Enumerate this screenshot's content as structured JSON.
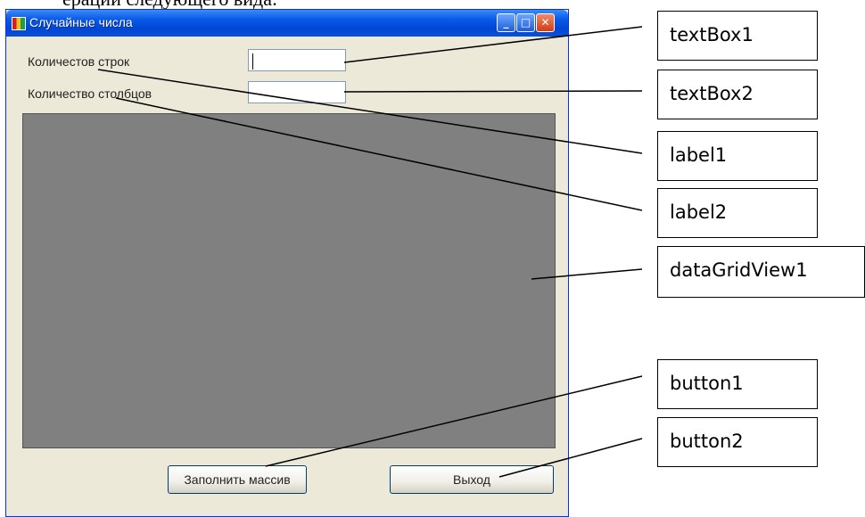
{
  "cutoff_text": "ерации следующего вида:",
  "window": {
    "title": "Случайные числа",
    "label_rows": "Количестов строк",
    "label_cols": "Количество столбцов",
    "button_fill": "Заполнить массив",
    "button_exit": "Выход"
  },
  "callouts": {
    "textBox1": "textBox1",
    "textBox2": "textBox2",
    "label1": "label1",
    "label2": "label2",
    "dataGridView1": "dataGridView1",
    "button1": "button1",
    "button2": "button2"
  },
  "colors": {
    "grid": "#808080",
    "window_bg": "#ece9d8",
    "titlebar": "#0046d5"
  }
}
